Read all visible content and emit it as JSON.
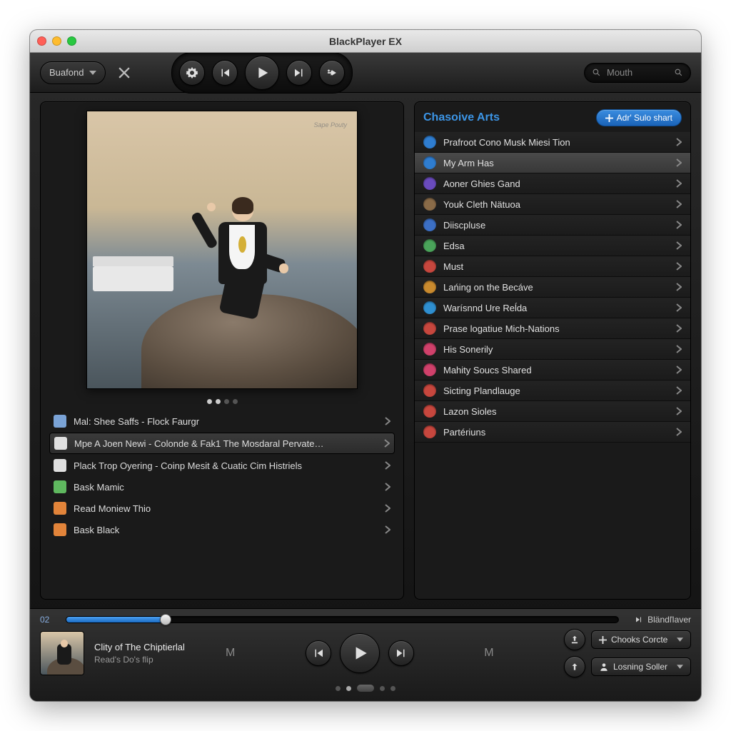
{
  "window": {
    "title": "BlackPlayer EX"
  },
  "toolbar": {
    "menu_label": "Buafond",
    "search_placeholder": "Mouth"
  },
  "album": {
    "watermark": "Sape Pouty"
  },
  "tracks": [
    {
      "label": "Mal: Shee Saffs - Flock Faurgr",
      "icon_color": "#7aa3d6"
    },
    {
      "label": "Mpe A Joen Newi - Colonde & Fak1 The Mosdaral Pervate…",
      "icon_color": "#e0e0e0"
    },
    {
      "label": "Plack Trop Oyering - Coinp Mesit & Cuatic Cim Histriels",
      "icon_color": "#e0e0e0"
    },
    {
      "label": "Bask Mamic",
      "icon_color": "#5fb85f"
    },
    {
      "label": "Read Moniew Thio",
      "icon_color": "#e2843a"
    },
    {
      "label": "Bask Black",
      "icon_color": "#e2843a"
    }
  ],
  "selected_track_index": 1,
  "right": {
    "title": "Chasoive Arts",
    "add_label": "Adr' Sulo shart",
    "selected_index": 1,
    "items": [
      {
        "label": "Prafroot Cono Musk Miesi Tion",
        "color": "#2f7dd0"
      },
      {
        "label": "My Arm Has",
        "color": "#2f7dd0"
      },
      {
        "label": "Aoner Ghies Gand",
        "color": "#6a4bbd"
      },
      {
        "label": "Youk Cleth Nätuoa",
        "color": "#8a6b48"
      },
      {
        "label": "Diiscpluse",
        "color": "#3c6fc4"
      },
      {
        "label": "Edsa",
        "color": "#4aa35a"
      },
      {
        "label": "Must",
        "color": "#c7473e"
      },
      {
        "label": "Lańing on the Becáve",
        "color": "#c98a2e"
      },
      {
        "label": "Warísnnd Ure Reĺda",
        "color": "#2f8fd0"
      },
      {
        "label": "Prase logatiue Mich-Nations",
        "color": "#c7473e"
      },
      {
        "label": "His Sonerily",
        "color": "#d0416b"
      },
      {
        "label": "Mahity Soucs Shared",
        "color": "#d0416b"
      },
      {
        "label": "Sicting Plandlauge",
        "color": "#c7473e"
      },
      {
        "label": "Lazon Sioles",
        "color": "#c7473e"
      },
      {
        "label": "Partériuns",
        "color": "#c7473e"
      }
    ]
  },
  "player": {
    "elapsed": "02",
    "brand": "BländľIaver",
    "now_title": "Clity of The Chiptierlal",
    "now_sub": "Read's Do's flip",
    "select1": "Chooks Corcte",
    "select2": "Losning Soller",
    "progress_pct": 18
  }
}
